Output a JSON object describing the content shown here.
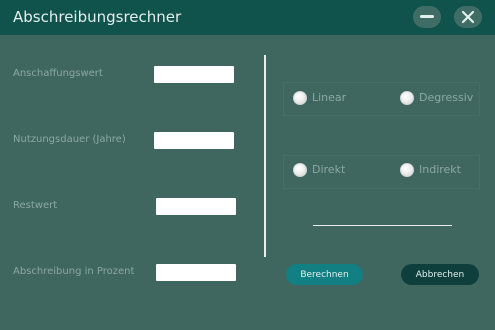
{
  "window": {
    "title": "Abschreibungsrechner",
    "minimize_icon": "minimize-icon",
    "close_icon": "close-icon"
  },
  "form": {
    "fields": [
      {
        "label": "Anschaffungswert",
        "value": ""
      },
      {
        "label": "Nutzungsdauer (Jahre)",
        "value": ""
      },
      {
        "label": "Restwert",
        "value": ""
      },
      {
        "label": "Abschreibung in Prozent",
        "value": ""
      }
    ]
  },
  "options": {
    "method": [
      {
        "label": "Linear",
        "selected": false
      },
      {
        "label": "Degressiv",
        "selected": false
      }
    ],
    "mode": [
      {
        "label": "Direkt",
        "selected": false
      },
      {
        "label": "Indirekt",
        "selected": false
      }
    ]
  },
  "buttons": {
    "calculate": "Berechnen",
    "cancel": "Abbrechen"
  },
  "colors": {
    "background": "#3f6760",
    "titlebar": "#10524c",
    "calculate_button": "#127f83",
    "cancel_button": "#0e3f3d"
  }
}
